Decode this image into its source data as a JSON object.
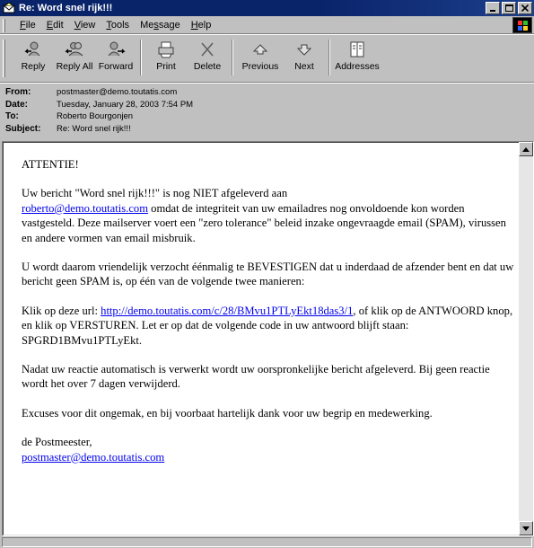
{
  "window": {
    "title": "Re: Word snel rijk!!!",
    "controls": {
      "minimize": "_",
      "maximize": "□",
      "close": "×"
    }
  },
  "menu": {
    "items": [
      {
        "accel": "F",
        "rest": "ile"
      },
      {
        "accel": "E",
        "rest": "dit"
      },
      {
        "accel": "V",
        "rest": "iew"
      },
      {
        "accel": "T",
        "rest": "ools"
      },
      {
        "pre": "Me",
        "accel": "s",
        "rest": "sage"
      },
      {
        "accel": "H",
        "rest": "elp"
      }
    ]
  },
  "toolbar": {
    "reply": "Reply",
    "reply_all": "Reply All",
    "forward": "Forward",
    "print": "Print",
    "delete": "Delete",
    "previous": "Previous",
    "next": "Next",
    "addresses": "Addresses"
  },
  "header": {
    "from_label": "From:",
    "from": "postmaster@demo.toutatis.com",
    "date_label": "Date:",
    "date": "Tuesday, January 28, 2003 7:54 PM",
    "to_label": "To:",
    "to": "Roberto Bourgonjen",
    "subject_label": "Subject:",
    "subject": "Re: Word snel rijk!!!"
  },
  "message": {
    "p1": "ATTENTIE!",
    "p2_a": "Uw bericht \"Word snel rijk!!!\" is nog NIET afgeleverd aan",
    "p2_link": "roberto@demo.toutatis.com",
    "p2_b": " omdat de integriteit van uw emailadres nog onvoldoende kon worden vastgesteld. Deze mailserver voert een \"zero tolerance\" beleid inzake ongevraagde email (SPAM), virussen en andere vormen van email misbruik.",
    "p3": "U wordt daarom vriendelijk verzocht éénmalig te BEVESTIGEN dat u inderdaad de afzender bent en dat uw bericht geen SPAM is, op één van de volgende twee manieren:",
    "p4_a": "Klik op deze url: ",
    "p4_link": "http://demo.toutatis.com/c/28/BMvu1PTLyEkt18das3/1",
    "p4_b": ", of klik op de ANTWOORD knop, en klik op VERSTUREN. Let er op dat de volgende code in uw antwoord blijft staan: SPGRD1BMvu1PTLyEkt.",
    "p5": "Nadat uw reactie automatisch is verwerkt wordt uw oorspronkelijke bericht afgeleverd. Bij geen reactie wordt het over 7 dagen verwijderd.",
    "p6": "Excuses voor dit ongemak, en bij voorbaat hartelijk dank voor uw begrip en medewerking.",
    "p7": "de Postmeester,",
    "p7_link": "postmaster@demo.toutatis.com"
  }
}
